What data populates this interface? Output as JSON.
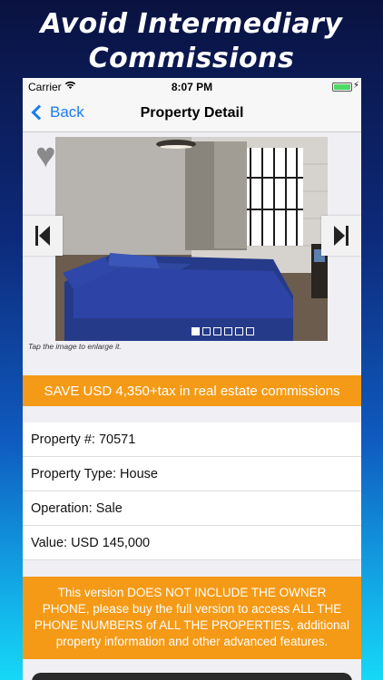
{
  "promo": {
    "line1": "Avoid Intermediary",
    "line2": "Commissions"
  },
  "status_bar": {
    "carrier": "Carrier",
    "time": "8:07 PM"
  },
  "nav": {
    "back_label": "Back",
    "title": "Property Detail"
  },
  "gallery": {
    "caption": "Tap the image to enlarge it.",
    "page_count": 6,
    "current_page": 1
  },
  "save_banner": "SAVE USD 4,350+tax in real estate commissions",
  "details": [
    {
      "text": "Property #: 70571"
    },
    {
      "text": "Property Type: House"
    },
    {
      "text": "Operation: Sale"
    },
    {
      "text": "Value: USD 145,000"
    }
  ],
  "notice": "This version DOES NOT INCLUDE THE OWNER PHONE, please buy the full version to access ALL THE PHONE NUMBERS of ALL THE PROPERTIES, additional property information and other advanced features.",
  "colors": {
    "accent": "#f59a16",
    "link": "#1a7cf5"
  }
}
